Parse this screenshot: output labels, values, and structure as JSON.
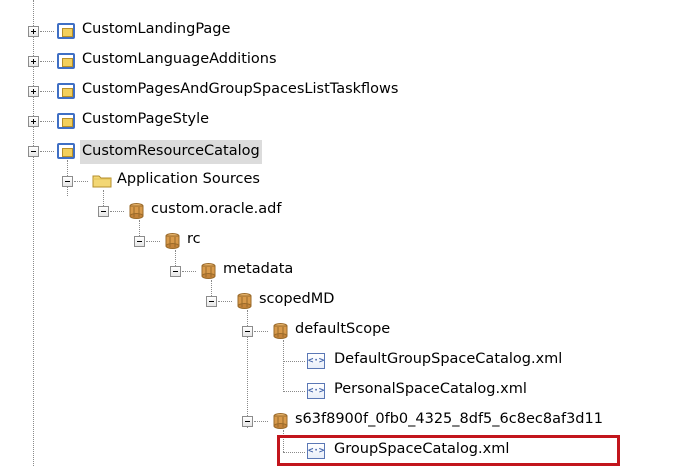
{
  "tree": {
    "nodes": [
      {
        "label": "CustomLandingPage",
        "type": "project",
        "expander": "plus"
      },
      {
        "label": "CustomLanguageAdditions",
        "type": "project",
        "expander": "plus"
      },
      {
        "label": "CustomPagesAndGroupSpacesListTaskflows",
        "type": "project",
        "expander": "plus"
      },
      {
        "label": "CustomPageStyle",
        "type": "project",
        "expander": "plus"
      },
      {
        "label": "CustomResourceCatalog",
        "type": "project",
        "expander": "minus",
        "selected": true
      },
      {
        "label": "Application Sources",
        "type": "folder",
        "expander": "minus"
      },
      {
        "label": "custom.oracle.adf",
        "type": "package",
        "expander": "minus"
      },
      {
        "label": "rc",
        "type": "package",
        "expander": "minus"
      },
      {
        "label": "metadata",
        "type": "package",
        "expander": "minus"
      },
      {
        "label": "scopedMD",
        "type": "package",
        "expander": "minus"
      },
      {
        "label": "defaultScope",
        "type": "package",
        "expander": "minus"
      },
      {
        "label": "DefaultGroupSpaceCatalog.xml",
        "type": "xml-file"
      },
      {
        "label": "PersonalSpaceCatalog.xml",
        "type": "xml-file"
      },
      {
        "label": "s63f8900f_0fb0_4325_8df5_6c8ec8af3d11",
        "type": "package",
        "expander": "minus"
      },
      {
        "label": "GroupSpaceCatalog.xml",
        "type": "xml-file",
        "highlighted": true
      }
    ],
    "xml_glyph": "<·>"
  }
}
